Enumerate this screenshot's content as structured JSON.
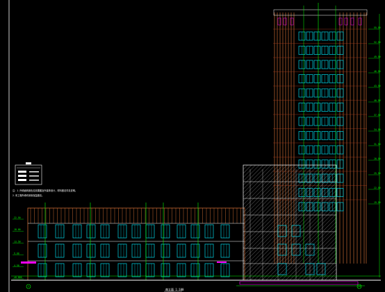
{
  "drawing": {
    "title": "南立面 1:100",
    "colors": {
      "background": "#000000",
      "frame": "#ffffff",
      "facade_brown": "#c86a32",
      "window_cyan": "#00d8e8",
      "dim_green": "#00ff00",
      "hatch_gray": "#9a9a9a",
      "accent_magenta": "#ff00ff"
    },
    "legend": {
      "note_line_1": "注：1.外墙面砖颜色见效果图及外装饰设计，材料做法详见说明。",
      "note_line_2": "2.本工程外墙均采用保温做法。"
    },
    "level_marks_left": [
      "22.50",
      "18.00",
      "13.50",
      "9.00",
      "4.50",
      "±0.000"
    ],
    "level_marks_right": [
      "55.50",
      "52.50",
      "49.50",
      "46.50",
      "43.50",
      "40.50",
      "37.50",
      "34.50",
      "31.50",
      "28.50",
      "25.50",
      "22.50",
      "19.50"
    ],
    "axis_tags": [
      "1",
      "23"
    ]
  }
}
